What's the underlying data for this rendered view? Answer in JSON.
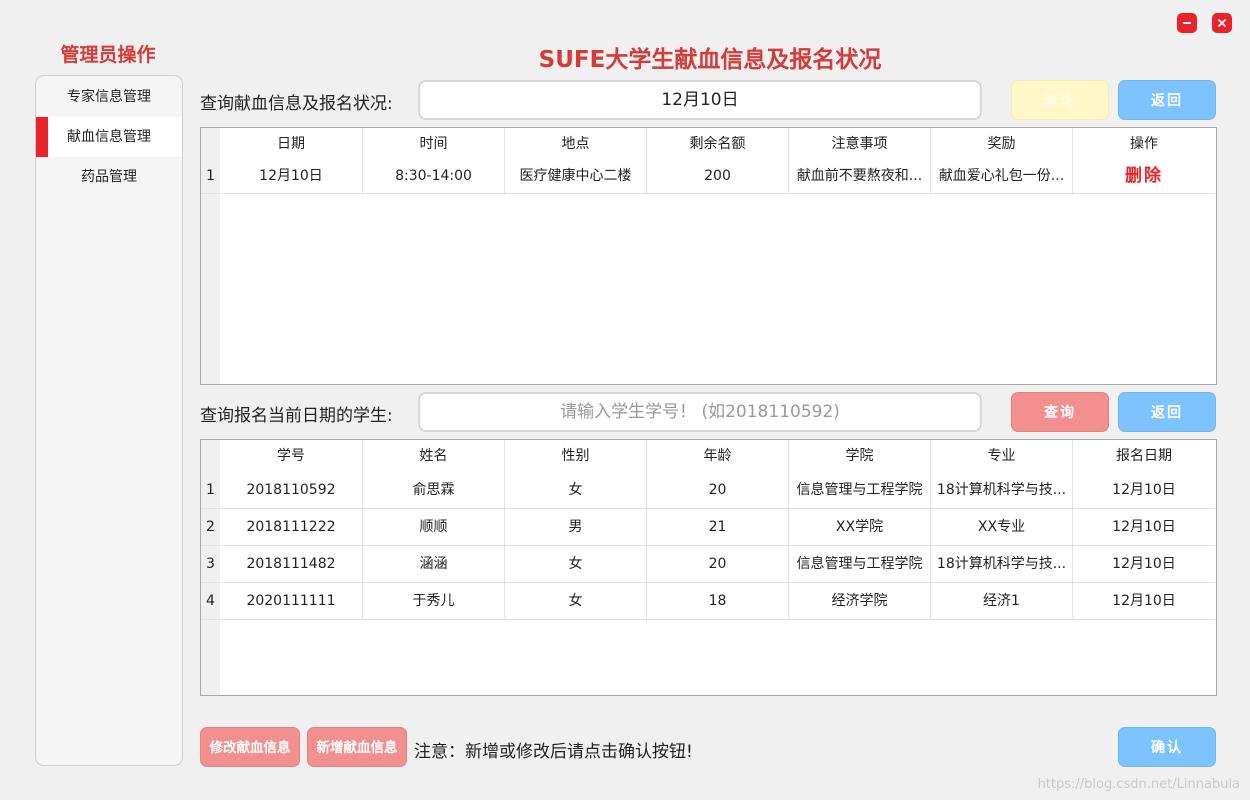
{
  "window": {
    "minimize_label": "—",
    "close_label": "✕"
  },
  "sidebar": {
    "title": "管理员操作",
    "items": [
      {
        "label": "专家信息管理",
        "active": false
      },
      {
        "label": "献血信息管理",
        "active": true
      },
      {
        "label": "药品管理",
        "active": false
      }
    ]
  },
  "header": {
    "title": "SUFE大学生献血信息及报名状况"
  },
  "donation_query": {
    "label": "查询献血信息及报名状况:",
    "value": "12月10日",
    "query_button": "查询",
    "back_button": "返回"
  },
  "donation_table": {
    "columns": [
      "日期",
      "时间",
      "地点",
      "剩余名额",
      "注意事项",
      "奖励",
      "操作"
    ],
    "rows": [
      {
        "num": "1",
        "date": "12月10日",
        "time": "8:30-14:00",
        "place": "医疗健康中心二楼",
        "remaining": "200",
        "notes": "献血前不要熬夜和...",
        "reward": "献血爱心礼包一份...",
        "action": "删除"
      }
    ]
  },
  "student_query": {
    "label": "查询报名当前日期的学生:",
    "placeholder": "请输入学生学号！  (如2018110592)",
    "query_button": "查询",
    "back_button": "返回"
  },
  "student_table": {
    "columns": [
      "学号",
      "姓名",
      "性别",
      "年龄",
      "学院",
      "专业",
      "报名日期"
    ],
    "rows": [
      {
        "num": "1",
        "id": "2018110592",
        "name": "俞思霖",
        "gender": "女",
        "age": "20",
        "college": "信息管理与工程学院",
        "major": "18计算机科学与技...",
        "date": "12月10日"
      },
      {
        "num": "2",
        "id": "2018111222",
        "name": "顺顺",
        "gender": "男",
        "age": "21",
        "college": "XX学院",
        "major": "XX专业",
        "date": "12月10日"
      },
      {
        "num": "3",
        "id": "2018111482",
        "name": "涵涵",
        "gender": "女",
        "age": "20",
        "college": "信息管理与工程学院",
        "major": "18计算机科学与技...",
        "date": "12月10日"
      },
      {
        "num": "4",
        "id": "2020111111",
        "name": "于秀儿",
        "gender": "女",
        "age": "18",
        "college": "经济学院",
        "major": "经济1",
        "date": "12月10日"
      }
    ]
  },
  "footer": {
    "modify_button": "修改献血信息",
    "add_button": "新增献血信息",
    "note": "注意：新增或修改后请点击确认按钮!",
    "confirm_button": "确认"
  },
  "watermark": "https://blog.csdn.net/Linnabula",
  "colors": {
    "accent_red": "#e8232a",
    "title_red": "#d63a3a",
    "button_blue": "#7cc3ff",
    "button_pink": "#f29090",
    "button_yellow": "#fff7c7"
  }
}
